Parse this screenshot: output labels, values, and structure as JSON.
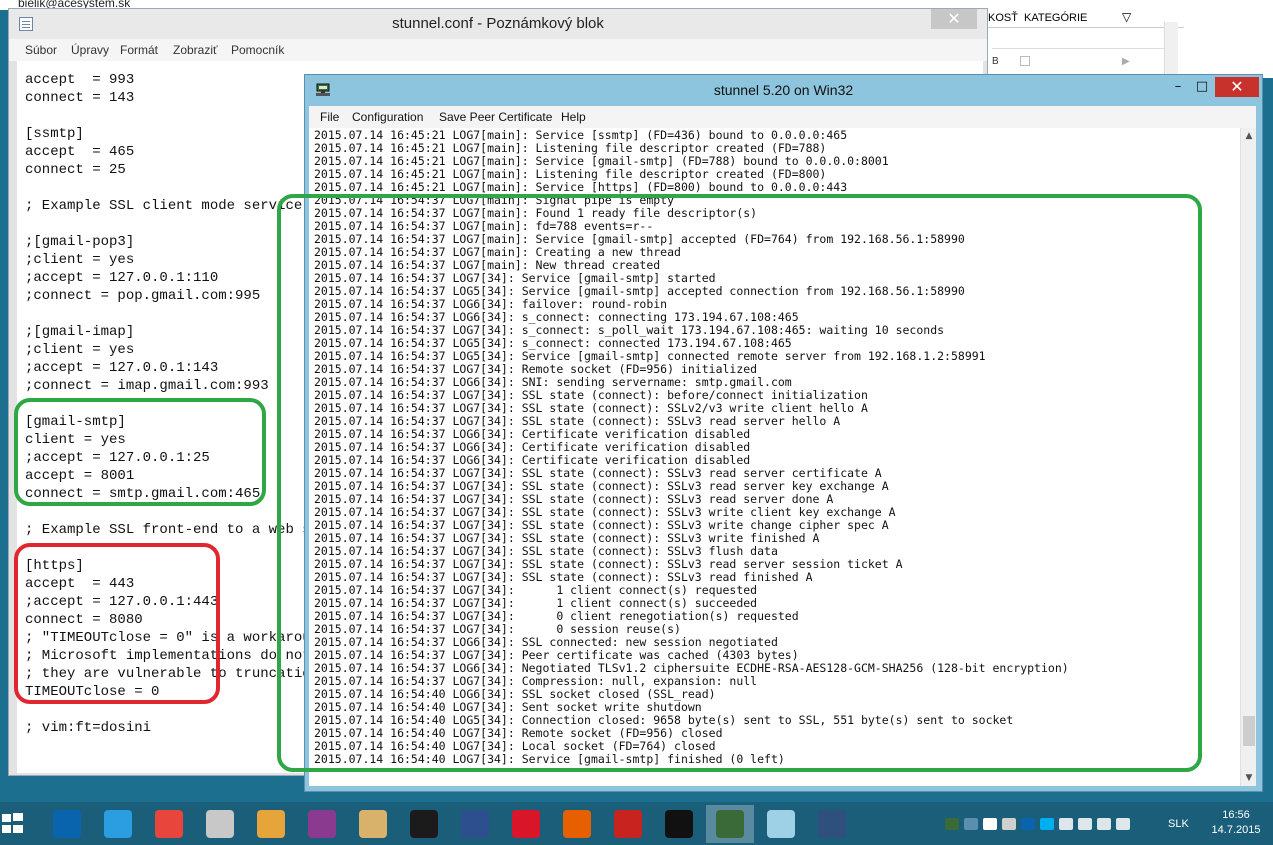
{
  "background": {
    "email_fragment": "bielik@acesystem.sk",
    "panel_headers": [
      "KOSŤ",
      "KATEGÓRIE"
    ],
    "row_letter": "B"
  },
  "notepad": {
    "title": "stunnel.conf - Poznámkový blok",
    "close_label": "✕",
    "menu": [
      "Súbor",
      "Úpravy",
      "Formát",
      "Zobraziť",
      "Pomocník"
    ],
    "lines": [
      "accept  = 993",
      "connect = 143",
      "",
      "[ssmtp]",
      "accept  = 465",
      "connect = 25",
      "",
      "; Example SSL client mode service",
      "",
      ";[gmail-pop3]",
      ";client = yes",
      ";accept = 127.0.0.1:110",
      ";connect = pop.gmail.com:995",
      "",
      ";[gmail-imap]",
      ";client = yes",
      ";accept = 127.0.0.1:143",
      ";connect = imap.gmail.com:993",
      "",
      "[gmail-smtp]",
      "client = yes",
      ";accept = 127.0.0.1:25",
      "accept = 8001",
      "connect = smtp.gmail.com:465",
      "",
      "; Example SSL front-end to a web se",
      "",
      "[https]",
      "accept  = 443",
      ";accept = 127.0.0.1:443",
      "connect = 8080",
      "; \"TIMEOUTclose = 0\" is a workaroun",
      "; Microsoft implementations do not",
      "; they are vulnerable to truncation",
      "TIMEOUTclose = 0",
      "",
      "; vim:ft=dosini"
    ]
  },
  "stunnel": {
    "title": "stunnel 5.20 on Win32",
    "minimize_label": "–",
    "maximize_label": "□",
    "close_label": "✕",
    "menu": [
      "File",
      "Configuration",
      "Save Peer Certificate",
      "Help"
    ],
    "log_lines": [
      "2015.07.14 16:45:21 LOG7[main]: Service [ssmtp] (FD=436) bound to 0.0.0.0:465",
      "2015.07.14 16:45:21 LOG7[main]: Listening file descriptor created (FD=788)",
      "2015.07.14 16:45:21 LOG7[main]: Service [gmail-smtp] (FD=788) bound to 0.0.0.0:8001",
      "2015.07.14 16:45:21 LOG7[main]: Listening file descriptor created (FD=800)",
      "2015.07.14 16:45:21 LOG7[main]: Service [https] (FD=800) bound to 0.0.0.0:443",
      "2015.07.14 16:54:37 LOG7[main]: Signal pipe is empty",
      "2015.07.14 16:54:37 LOG7[main]: Found 1 ready file descriptor(s)",
      "2015.07.14 16:54:37 LOG7[main]: fd=788 events=r--",
      "2015.07.14 16:54:37 LOG7[main]: Service [gmail-smtp] accepted (FD=764) from 192.168.56.1:58990",
      "2015.07.14 16:54:37 LOG7[main]: Creating a new thread",
      "2015.07.14 16:54:37 LOG7[main]: New thread created",
      "2015.07.14 16:54:37 LOG7[34]: Service [gmail-smtp] started",
      "2015.07.14 16:54:37 LOG5[34]: Service [gmail-smtp] accepted connection from 192.168.56.1:58990",
      "2015.07.14 16:54:37 LOG6[34]: failover: round-robin",
      "2015.07.14 16:54:37 LOG6[34]: s_connect: connecting 173.194.67.108:465",
      "2015.07.14 16:54:37 LOG7[34]: s_connect: s_poll_wait 173.194.67.108:465: waiting 10 seconds",
      "2015.07.14 16:54:37 LOG5[34]: s_connect: connected 173.194.67.108:465",
      "2015.07.14 16:54:37 LOG5[34]: Service [gmail-smtp] connected remote server from 192.168.1.2:58991",
      "2015.07.14 16:54:37 LOG7[34]: Remote socket (FD=956) initialized",
      "2015.07.14 16:54:37 LOG6[34]: SNI: sending servername: smtp.gmail.com",
      "2015.07.14 16:54:37 LOG7[34]: SSL state (connect): before/connect initialization",
      "2015.07.14 16:54:37 LOG7[34]: SSL state (connect): SSLv2/v3 write client hello A",
      "2015.07.14 16:54:37 LOG7[34]: SSL state (connect): SSLv3 read server hello A",
      "2015.07.14 16:54:37 LOG6[34]: Certificate verification disabled",
      "2015.07.14 16:54:37 LOG6[34]: Certificate verification disabled",
      "2015.07.14 16:54:37 LOG6[34]: Certificate verification disabled",
      "2015.07.14 16:54:37 LOG7[34]: SSL state (connect): SSLv3 read server certificate A",
      "2015.07.14 16:54:37 LOG7[34]: SSL state (connect): SSLv3 read server key exchange A",
      "2015.07.14 16:54:37 LOG7[34]: SSL state (connect): SSLv3 read server done A",
      "2015.07.14 16:54:37 LOG7[34]: SSL state (connect): SSLv3 write client key exchange A",
      "2015.07.14 16:54:37 LOG7[34]: SSL state (connect): SSLv3 write change cipher spec A",
      "2015.07.14 16:54:37 LOG7[34]: SSL state (connect): SSLv3 write finished A",
      "2015.07.14 16:54:37 LOG7[34]: SSL state (connect): SSLv3 flush data",
      "2015.07.14 16:54:37 LOG7[34]: SSL state (connect): SSLv3 read server session ticket A",
      "2015.07.14 16:54:37 LOG7[34]: SSL state (connect): SSLv3 read finished A",
      "2015.07.14 16:54:37 LOG7[34]:      1 client connect(s) requested",
      "2015.07.14 16:54:37 LOG7[34]:      1 client connect(s) succeeded",
      "2015.07.14 16:54:37 LOG7[34]:      0 client renegotiation(s) requested",
      "2015.07.14 16:54:37 LOG7[34]:      0 session reuse(s)",
      "2015.07.14 16:54:37 LOG6[34]: SSL connected: new session negotiated",
      "2015.07.14 16:54:37 LOG7[34]: Peer certificate was cached (4303 bytes)",
      "2015.07.14 16:54:37 LOG6[34]: Negotiated TLSv1.2 ciphersuite ECDHE-RSA-AES128-GCM-SHA256 (128-bit encryption)",
      "2015.07.14 16:54:37 LOG7[34]: Compression: null, expansion: null",
      "2015.07.14 16:54:40 LOG6[34]: SSL socket closed (SSL_read)",
      "2015.07.14 16:54:40 LOG7[34]: Sent socket write shutdown",
      "2015.07.14 16:54:40 LOG5[34]: Connection closed: 9658 byte(s) sent to SSL, 551 byte(s) sent to socket",
      "2015.07.14 16:54:40 LOG7[34]: Remote socket (FD=956) closed",
      "2015.07.14 16:54:40 LOG7[34]: Local socket (FD=764) closed",
      "2015.07.14 16:54:40 LOG7[34]: Service [gmail-smtp] finished (0 left)"
    ]
  },
  "annotations": {
    "gmail_box_color": "#2fa745",
    "https_box_color": "#e1262f",
    "log_box_color": "#2fa745"
  },
  "taskbar": {
    "items": [
      {
        "name": "outlook-icon",
        "color": "#0a64ad"
      },
      {
        "name": "internet-explorer-icon",
        "color": "#2a9ee0"
      },
      {
        "name": "chrome-icon",
        "color": "#e8453c"
      },
      {
        "name": "calculator-icon",
        "color": "#c8c8c8"
      },
      {
        "name": "paint-icon",
        "color": "#e7a43b"
      },
      {
        "name": "save-disk-icon",
        "color": "#8a3b8f"
      },
      {
        "name": "certificate-icon",
        "color": "#d8b26a"
      },
      {
        "name": "pixel-app-icon",
        "color": "#1b1b1b"
      },
      {
        "name": "network-user-icon",
        "color": "#2d4f8e"
      },
      {
        "name": "opera-icon",
        "color": "#d9152a"
      },
      {
        "name": "firefox-icon",
        "color": "#e66000"
      },
      {
        "name": "red-c-app-icon",
        "color": "#c8231f"
      },
      {
        "name": "console-icon",
        "color": "#111111"
      },
      {
        "name": "stunnel-icon",
        "color": "#3a6a38"
      },
      {
        "name": "notepad-icon",
        "color": "#9ed1e6"
      },
      {
        "name": "window-manager-icon",
        "color": "#2f4f7c"
      }
    ],
    "active_index": 13,
    "tray_icons": [
      "stunnel-tray-icon",
      "network-tray-icon",
      "windows-tray-icon",
      "monitor-tray-icon",
      "outlook-tray-icon",
      "skype-tray-icon",
      "volume-icon",
      "flag-icon",
      "wifi-icon",
      "battery-icon"
    ],
    "language": "SLK",
    "time": "16:56",
    "date": "14.7.2015"
  }
}
